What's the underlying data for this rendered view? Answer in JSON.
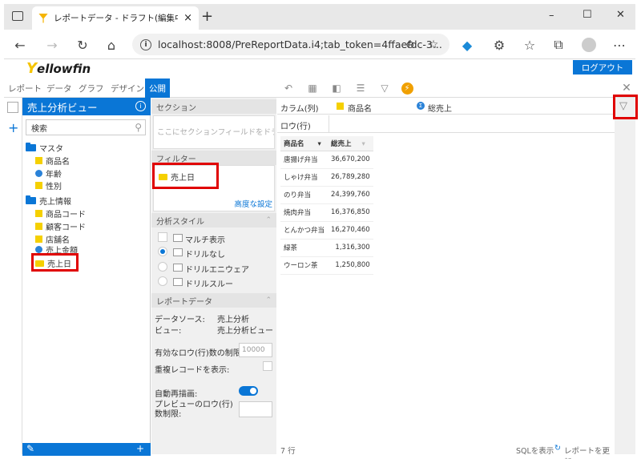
{
  "browser": {
    "tab_title": "レポートデータ - ドラフト(編集中)レポ",
    "tab_close": "×",
    "new_tab": "+",
    "window_controls": [
      "–",
      "☐",
      "✕"
    ],
    "url": "localhost:8008/PreReportData.i4;tab_token=4ffaefdc-3..."
  },
  "app": {
    "logo_y": "Y",
    "logo_text": "ellowfin",
    "logout_label": "ログアウト",
    "tabs": [
      "レポート",
      "データ",
      "グラフ",
      "デザイン",
      "公開"
    ],
    "active_tab": "公開"
  },
  "left": {
    "title": "売上分析ビュー",
    "info": "i",
    "search_placeholder": "検索",
    "tree": {
      "folder1": "マスタ",
      "folder1_items": [
        "商品名",
        "年齢",
        "性別"
      ],
      "folder2": "売上情報",
      "folder2_items": [
        "商品コード",
        "顧客コード",
        "店舗名",
        "売上金額",
        "売上日"
      ]
    }
  },
  "middle": {
    "section_title": "セクション",
    "section_hint": "ここにセクションフィールドをドラッグ",
    "filter_title": "フィルター",
    "filter_item": "売上日",
    "advanced_link": "高度な設定",
    "style_title": "分析スタイル",
    "style_options": [
      "マルチ表示",
      "ドリルなし",
      "ドリルエニウェア",
      "ドリルスルー"
    ],
    "report_data_title": "レポートデータ",
    "datasource_label": "データソース:",
    "datasource_value": "売上分析",
    "view_label": "ビュー:",
    "view_value": "売上分析ビュー",
    "row_limit_label": "有効なロウ(行)数の制限:",
    "row_limit_value": "10000",
    "dup_label": "重複レコードを表示:",
    "auto_label": "自動再描画:",
    "preview_label": "プレビューのロウ(行)数制限:"
  },
  "right": {
    "column_label": "カラム(列)",
    "column_field1": "商品名",
    "column_field2": "総売上",
    "row_label": "ロウ(行)",
    "table_headers": [
      "商品名",
      "総売上"
    ],
    "table_rows": [
      [
        "唐揚げ弁当",
        "36,670,200"
      ],
      [
        "しゃけ弁当",
        "26,789,280"
      ],
      [
        "のり弁当",
        "24,399,760"
      ],
      [
        "焼肉弁当",
        "16,376,850"
      ],
      [
        "とんかつ弁当",
        "16,270,460"
      ],
      [
        "緑茶",
        "1,316,300"
      ],
      [
        "ウーロン茶",
        "1,250,800"
      ]
    ],
    "row_count": "7 行",
    "sql_label": "SQLを表示",
    "refresh_label": "レポートを更新"
  }
}
